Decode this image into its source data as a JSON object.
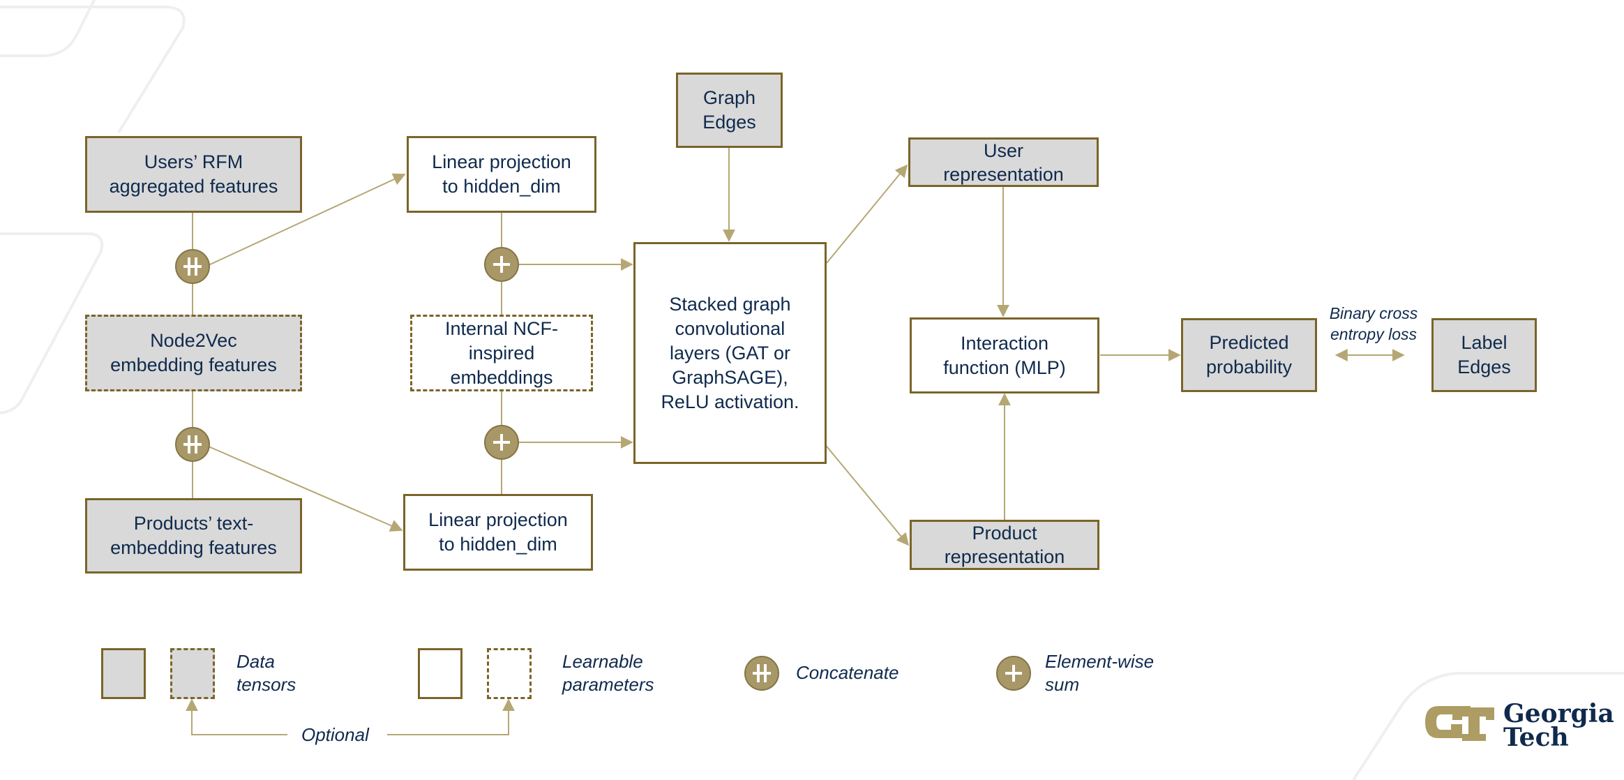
{
  "colors": {
    "box_border": "#7a6428",
    "data_fill": "#d9d9d9",
    "param_fill": "#ffffff",
    "connector": "#b5a774",
    "operator_fill": "#a89867",
    "operator_border": "#857446",
    "text": "#0f2a4d",
    "background_decoration": "#efefef"
  },
  "nodes": {
    "users_rfm": {
      "label": "Users’ RFM\naggregated features",
      "kind": "data",
      "optional": false
    },
    "node2vec": {
      "label": "Node2Vec\nembedding features",
      "kind": "data",
      "optional": true
    },
    "products_text": {
      "label": "Products’ text-\nembedding features",
      "kind": "data",
      "optional": false
    },
    "linear_proj_user": {
      "label": "Linear projection\nto hidden_dim",
      "kind": "learnable",
      "optional": false
    },
    "internal_ncf": {
      "label": "Internal  NCF-\ninspired\nembeddings",
      "kind": "learnable",
      "optional": true
    },
    "linear_proj_product": {
      "label": "Linear projection\nto hidden_dim",
      "kind": "learnable",
      "optional": false
    },
    "graph_edges": {
      "label": "Graph\nEdges",
      "kind": "data",
      "optional": false
    },
    "gcn": {
      "label": "Stacked graph\nconvolutional\nlayers (GAT or\nGraphSAGE),\nReLU activation.",
      "kind": "learnable",
      "optional": false
    },
    "user_repr": {
      "label": "User\nrepresentation",
      "kind": "data",
      "optional": false
    },
    "product_repr": {
      "label": "Product\nrepresentation",
      "kind": "data",
      "optional": false
    },
    "interaction": {
      "label": "Interaction\nfunction (MLP)",
      "kind": "learnable",
      "optional": false
    },
    "predicted": {
      "label": "Predicted\nprobability",
      "kind": "data",
      "optional": false
    },
    "label_edges": {
      "label": "Label\nEdges",
      "kind": "data",
      "optional": false
    }
  },
  "operators": {
    "concat_user": {
      "type": "concatenate"
    },
    "concat_product": {
      "type": "concatenate"
    },
    "sum_user": {
      "type": "element-wise sum"
    },
    "sum_product": {
      "type": "element-wise sum"
    }
  },
  "edges": [
    {
      "from": "users_rfm",
      "to": "concat_user"
    },
    {
      "from": "node2vec",
      "to": "concat_user"
    },
    {
      "from": "node2vec",
      "to": "concat_product"
    },
    {
      "from": "products_text",
      "to": "concat_product"
    },
    {
      "from": "concat_user",
      "to": "linear_proj_user"
    },
    {
      "from": "concat_product",
      "to": "linear_proj_product"
    },
    {
      "from": "linear_proj_user",
      "to": "sum_user"
    },
    {
      "from": "internal_ncf",
      "to": "sum_user"
    },
    {
      "from": "internal_ncf",
      "to": "sum_product"
    },
    {
      "from": "linear_proj_product",
      "to": "sum_product"
    },
    {
      "from": "sum_user",
      "to": "gcn"
    },
    {
      "from": "sum_product",
      "to": "gcn"
    },
    {
      "from": "graph_edges",
      "to": "gcn"
    },
    {
      "from": "gcn",
      "to": "user_repr"
    },
    {
      "from": "gcn",
      "to": "product_repr"
    },
    {
      "from": "user_repr",
      "to": "interaction"
    },
    {
      "from": "product_repr",
      "to": "interaction"
    },
    {
      "from": "interaction",
      "to": "predicted"
    },
    {
      "from": "predicted",
      "to": "label_edges",
      "bidirectional": true,
      "label": "Binary cross\nentropy loss"
    }
  ],
  "loss_label": "Binary cross\nentropy loss",
  "legend": {
    "data_tensors": "Data\ntensors",
    "learnable_parameters": "Learnable\nparameters",
    "optional": "Optional",
    "concatenate": "Concatenate",
    "elementwise_sum": "Element-wise\nsum"
  },
  "logo": {
    "monogram": "GT",
    "text": "Georgia\nTech"
  }
}
